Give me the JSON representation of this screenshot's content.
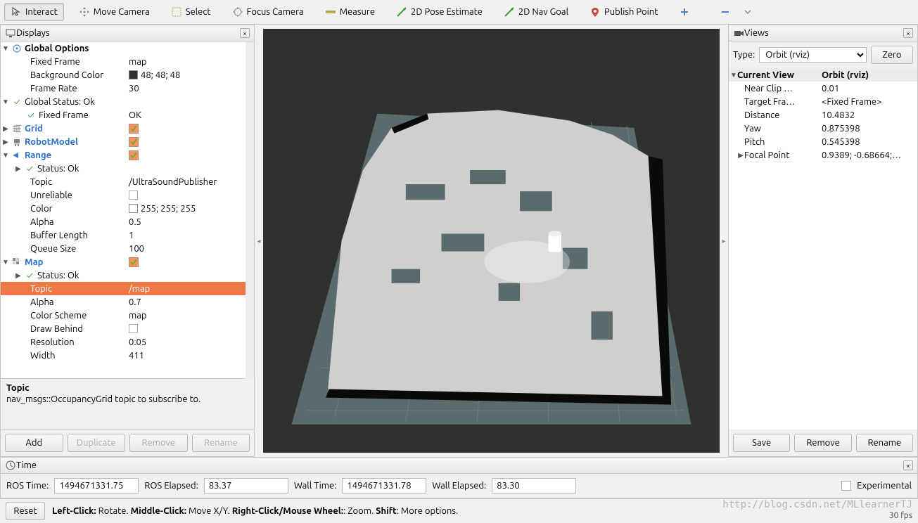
{
  "toolbar": {
    "interact": "Interact",
    "move_camera": "Move Camera",
    "select": "Select",
    "focus_camera": "Focus Camera",
    "measure": "Measure",
    "pose_estimate": "2D Pose Estimate",
    "nav_goal": "2D Nav Goal",
    "publish_point": "Publish Point"
  },
  "displays": {
    "title": "Displays",
    "global_options": {
      "label": "Global Options",
      "fixed_frame": {
        "label": "Fixed Frame",
        "value": "map"
      },
      "background_color": {
        "label": "Background Color",
        "value": "48; 48; 48"
      },
      "frame_rate": {
        "label": "Frame Rate",
        "value": "30"
      }
    },
    "global_status": {
      "label": "Global Status: Ok",
      "fixed_frame": {
        "label": "Fixed Frame",
        "value": "OK"
      }
    },
    "grid": {
      "label": "Grid"
    },
    "robot_model": {
      "label": "RobotModel"
    },
    "range": {
      "label": "Range",
      "status": "Status: Ok",
      "topic": {
        "label": "Topic",
        "value": "/UltraSoundPublisher"
      },
      "unreliable": {
        "label": "Unreliable"
      },
      "color": {
        "label": "Color",
        "value": "255; 255; 255"
      },
      "alpha": {
        "label": "Alpha",
        "value": "0.5"
      },
      "buffer_length": {
        "label": "Buffer Length",
        "value": "1"
      },
      "queue_size": {
        "label": "Queue Size",
        "value": "100"
      }
    },
    "map": {
      "label": "Map",
      "status": "Status: Ok",
      "topic": {
        "label": "Topic",
        "value": "/map"
      },
      "alpha": {
        "label": "Alpha",
        "value": "0.7"
      },
      "color_scheme": {
        "label": "Color Scheme",
        "value": "map"
      },
      "draw_behind": {
        "label": "Draw Behind"
      },
      "resolution": {
        "label": "Resolution",
        "value": "0.05"
      },
      "width": {
        "label": "Width",
        "value": "411"
      }
    },
    "description": {
      "title": "Topic",
      "text": "nav_msgs::OccupancyGrid topic to subscribe to."
    },
    "buttons": {
      "add": "Add",
      "duplicate": "Duplicate",
      "remove": "Remove",
      "rename": "Rename"
    }
  },
  "views": {
    "title": "Views",
    "type_label": "Type:",
    "type_value": "Orbit (rviz)",
    "zero": "Zero",
    "current_view": {
      "label": "Current View",
      "value": "Orbit (rviz)"
    },
    "near_clip": {
      "label": "Near Clip …",
      "value": "0.01"
    },
    "target_frame": {
      "label": "Target Fra…",
      "value": "<Fixed Frame>"
    },
    "distance": {
      "label": "Distance",
      "value": "10.4832"
    },
    "yaw": {
      "label": "Yaw",
      "value": "0.875398"
    },
    "pitch": {
      "label": "Pitch",
      "value": "0.545398"
    },
    "focal_point": {
      "label": "Focal Point",
      "value": "0.9389; -0.68664;…"
    },
    "buttons": {
      "save": "Save",
      "remove": "Remove",
      "rename": "Rename"
    }
  },
  "time": {
    "title": "Time",
    "ros_time": {
      "label": "ROS Time:",
      "value": "1494671331.75"
    },
    "ros_elapsed": {
      "label": "ROS Elapsed:",
      "value": "83.37"
    },
    "wall_time": {
      "label": "Wall Time:",
      "value": "1494671331.78"
    },
    "wall_elapsed": {
      "label": "Wall Elapsed:",
      "value": "83.30"
    },
    "experimental": "Experimental"
  },
  "bottom": {
    "reset": "Reset",
    "hints": {
      "left_click_label": "Left-Click:",
      "left_click": " Rotate. ",
      "middle_click_label": "Middle-Click:",
      "middle_click": " Move X/Y. ",
      "right_click_label": "Right-Click/Mouse Wheel:",
      "right_click": ": Zoom. ",
      "shift_label": "Shift",
      "shift": ": More options."
    },
    "fps": "30 fps",
    "watermark": "http://blog.csdn.net/MLlearnerTJ"
  }
}
